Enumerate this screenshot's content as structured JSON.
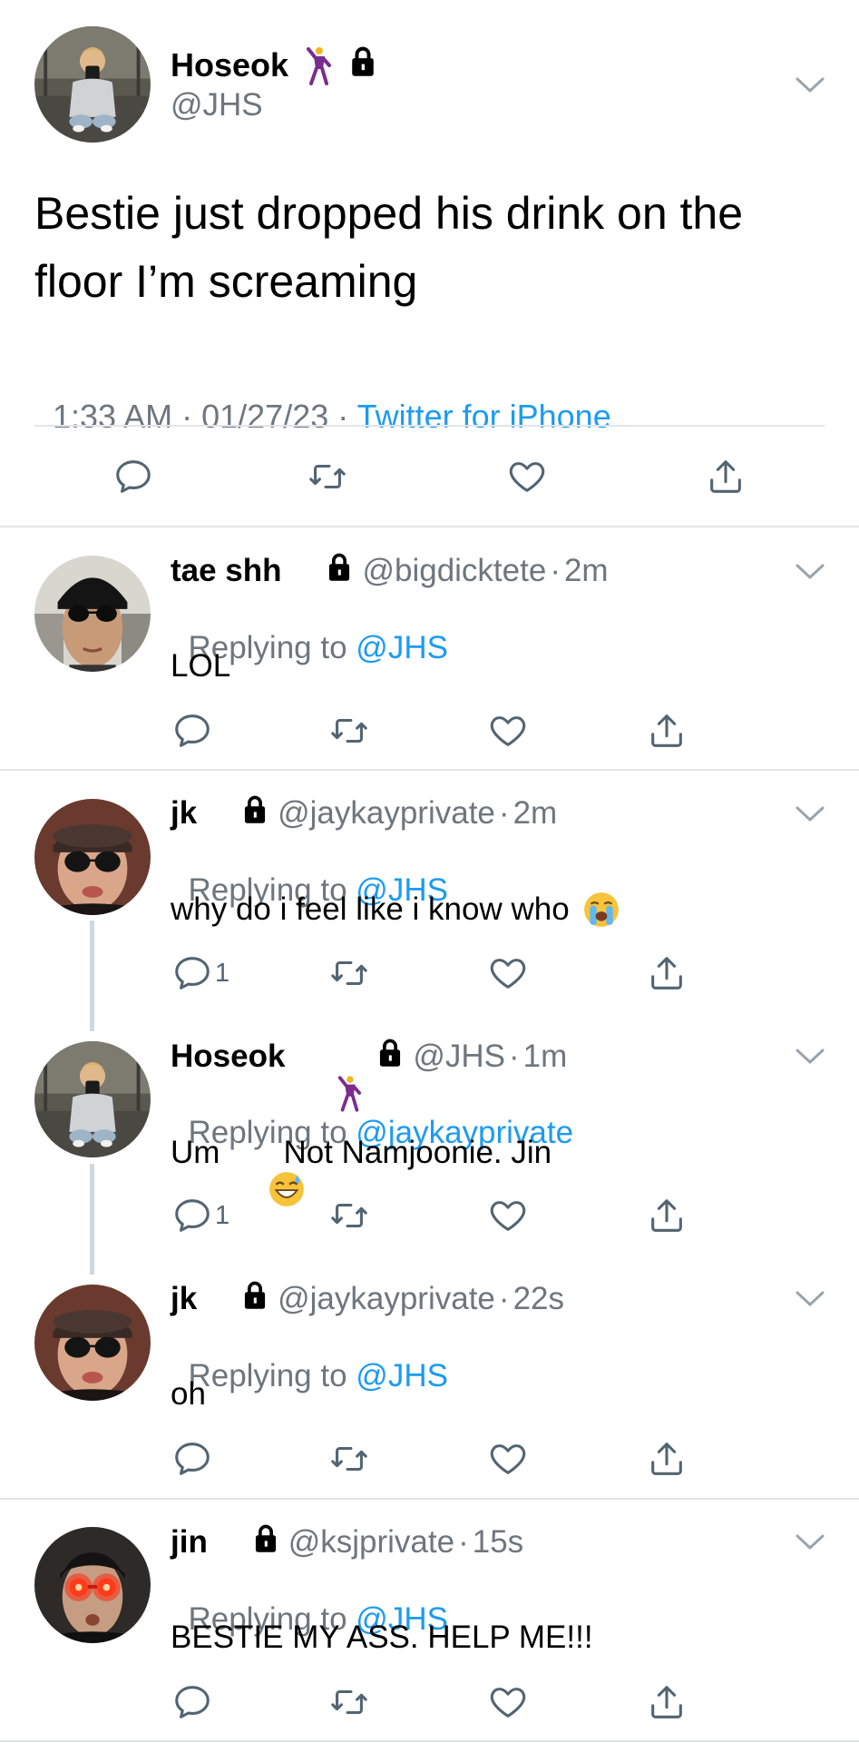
{
  "main_tweet": {
    "name": "Hoseok",
    "handle": "@JHS",
    "text_line1": "Bestie just dropped his drink on the",
    "text_line2": "floor I’m screaming",
    "time": "1:33 AM",
    "sep1": " · ",
    "date": "01/27/23",
    "sep2": " · ",
    "source": "Twitter for iPhone"
  },
  "replies": [
    {
      "name": "tae shh",
      "handle": "@bigdicktete",
      "time": "2m",
      "replying_prefix": "Replying to",
      "replying_to": "@JHS",
      "text": "LOL",
      "reply_count": ""
    },
    {
      "name": "jk",
      "handle": "@jaykayprivate",
      "time": "2m",
      "replying_prefix": "Replying to",
      "replying_to": "@JHS",
      "text": "why do i feel like i know who",
      "reply_count": "1"
    },
    {
      "name": "Hoseok",
      "handle": "@JHS",
      "time": "1m",
      "replying_prefix": "Replying to",
      "replying_to": "@jaykayprivate",
      "text_before_emoji": "Um",
      "text_after_emoji": "Not Namjoonie. Jin",
      "reply_count": "1"
    },
    {
      "name": "jk",
      "handle": "@jaykayprivate",
      "time": "22s",
      "replying_prefix": "Replying to",
      "replying_to": "@JHS",
      "text": "oh",
      "reply_count": ""
    },
    {
      "name": "jin",
      "handle": "@ksjprivate",
      "time": "15s",
      "replying_prefix": "Replying to",
      "replying_to": "@JHS",
      "text": "BESTIE MY ASS. HELP ME!!!",
      "reply_count": ""
    }
  ],
  "dot": "·",
  "icons": {
    "reply": "reply-icon",
    "retweet": "retweet-icon",
    "like": "heart-icon",
    "share": "share-icon",
    "more": "chevron-down-icon",
    "protected": "lock-icon",
    "dancer": "dancer-emoji"
  },
  "colors": {
    "link": "#1d9bf0",
    "secondary": "#6e767d",
    "divider": "#e1e4e8",
    "thread_line": "#cfd9de"
  }
}
